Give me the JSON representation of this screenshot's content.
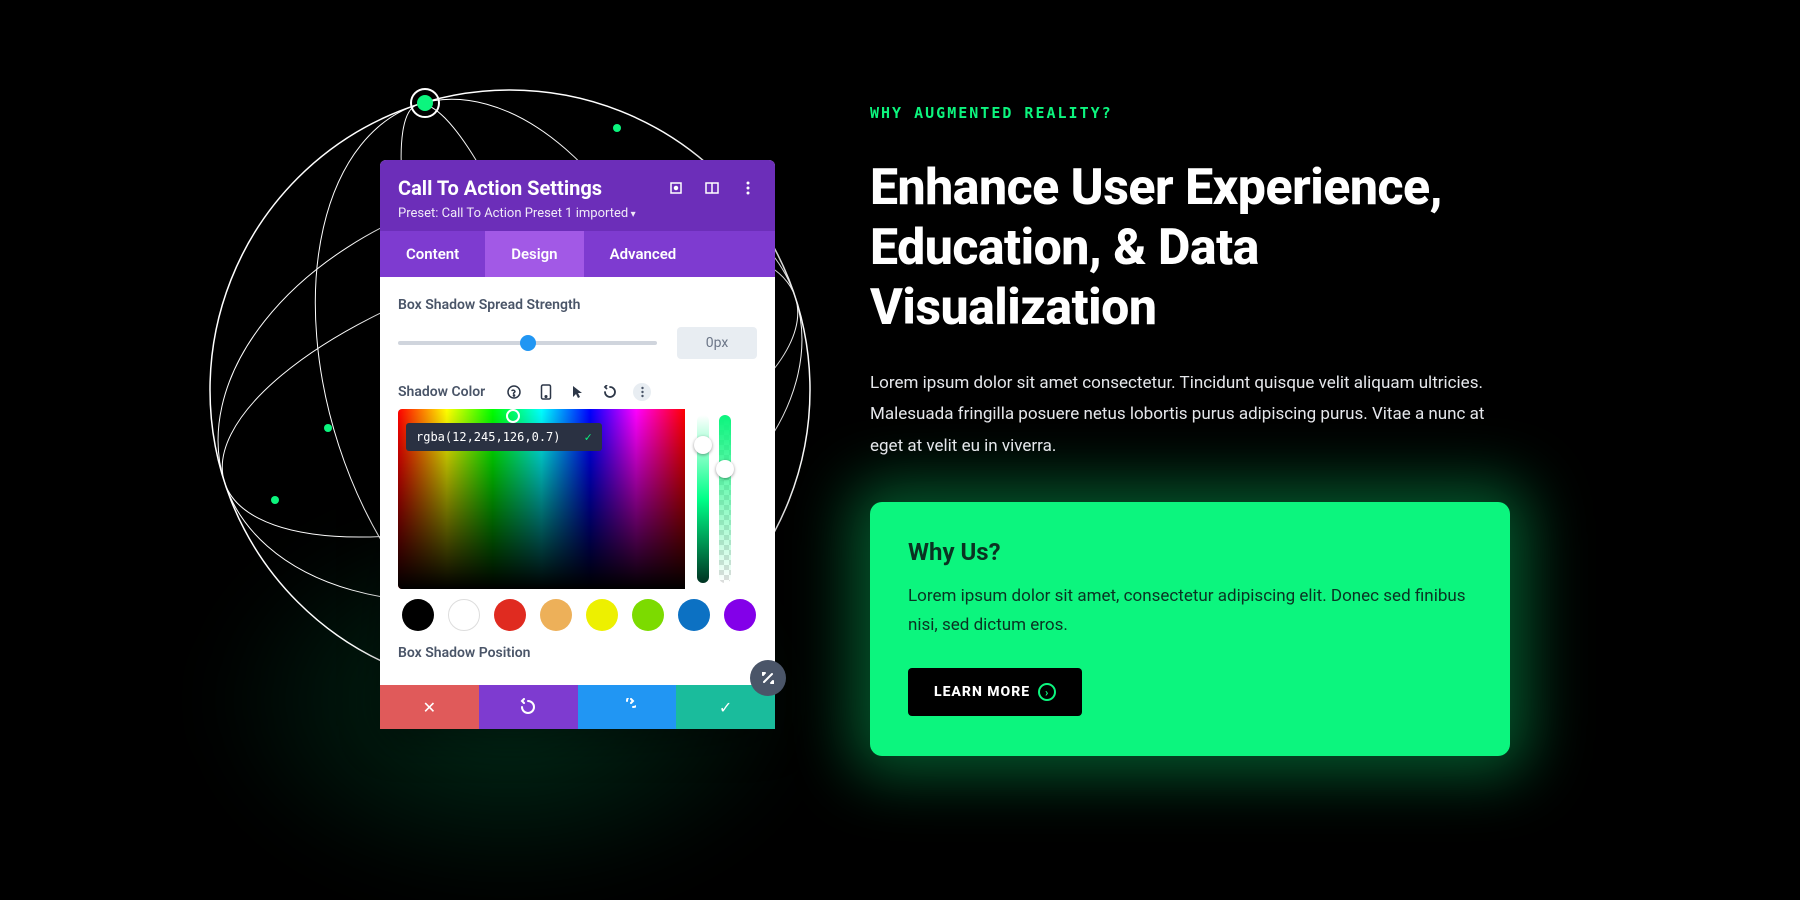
{
  "panel": {
    "title": "Call To Action Settings",
    "preset": "Preset: Call To Action Preset 1 imported",
    "tabs": {
      "content": "Content",
      "design": "Design",
      "advanced": "Advanced"
    },
    "fields": {
      "spread_label": "Box Shadow Spread Strength",
      "spread_value": "0px",
      "shadow_color_label": "Shadow Color",
      "shadow_color_value": "rgba(12,245,126,0.7)",
      "position_label": "Box Shadow Position"
    },
    "swatches": [
      "#000000",
      "#ffffff",
      "#e02b20",
      "#edb059",
      "#edf000",
      "#7cdb00",
      "#0c71c3",
      "#8300e9"
    ]
  },
  "content": {
    "eyebrow": "WHY AUGMENTED REALITY?",
    "headline": "Enhance User Experience, Education, & Data Visualization",
    "body": "Lorem ipsum dolor sit amet consectetur. Tincidunt quisque velit aliquam ultricies. Malesuada fringilla posuere netus lobortis purus adipiscing purus. Vitae a nunc at eget at velit eu in viverra.",
    "card": {
      "title": "Why Us?",
      "text": "Lorem ipsum dolor sit amet, consectetur adipiscing elit. Donec sed finibus nisi, sed dictum eros.",
      "button": "LEARN MORE"
    }
  }
}
